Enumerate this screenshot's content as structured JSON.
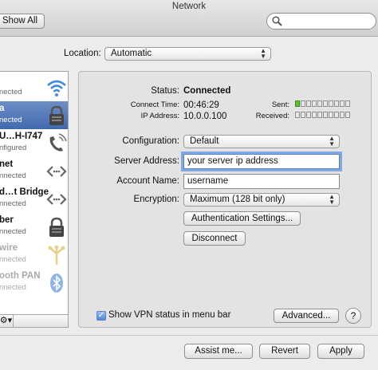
{
  "window": {
    "title": "Network"
  },
  "toolbar": {
    "show_all_label": "Show All",
    "search_placeholder": ""
  },
  "location": {
    "label": "Location:",
    "value": "Automatic"
  },
  "sidebar": {
    "items": [
      {
        "name": "",
        "status": "nected",
        "icon": "wifi-icon"
      },
      {
        "name": "a",
        "status": "nected",
        "icon": "lock-icon",
        "selected": true
      },
      {
        "name": "U…H-I747",
        "status": "nfigured",
        "icon": "phone-icon"
      },
      {
        "name": "net",
        "status": "nnected",
        "icon": "ethernet-arrows-icon"
      },
      {
        "name": "d…t Bridge",
        "status": "nnected",
        "icon": "ethernet-arrows-icon"
      },
      {
        "name": "ber",
        "status": "nnected",
        "icon": "lock-icon"
      },
      {
        "name": "wire",
        "status": "nnected",
        "icon": "firewire-icon"
      },
      {
        "name": "ooth PAN",
        "status": "nnected",
        "icon": "bluetooth-icon"
      }
    ]
  },
  "status_section": {
    "status_label": "Status:",
    "status_value": "Connected",
    "connect_time_label": "Connect Time:",
    "connect_time_value": "00:46:29",
    "ip_label": "IP Address:",
    "ip_value": "10.0.0.100",
    "sent_label": "Sent:",
    "received_label": "Received:",
    "sent_level": 0.1,
    "received_level": 0.0
  },
  "form": {
    "configuration_label": "Configuration:",
    "configuration_value": "Default",
    "server_label": "Server Address:",
    "server_value": "your server ip address",
    "account_label": "Account Name:",
    "account_value": "username",
    "encryption_label": "Encryption:",
    "encryption_value": "Maximum (128 bit only)",
    "auth_button": "Authentication Settings...",
    "disconnect_button": "Disconnect"
  },
  "footer": {
    "show_vpn_label": "Show VPN status in menu bar",
    "show_vpn_checked": true,
    "advanced_button": "Advanced...",
    "help_button": "?",
    "assist_button": "Assist me...",
    "revert_button": "Revert",
    "apply_button": "Apply"
  },
  "colors": {
    "selection": "#4a70b6",
    "focus_ring": "#7fa7e3",
    "meter_on": "#57c332"
  }
}
